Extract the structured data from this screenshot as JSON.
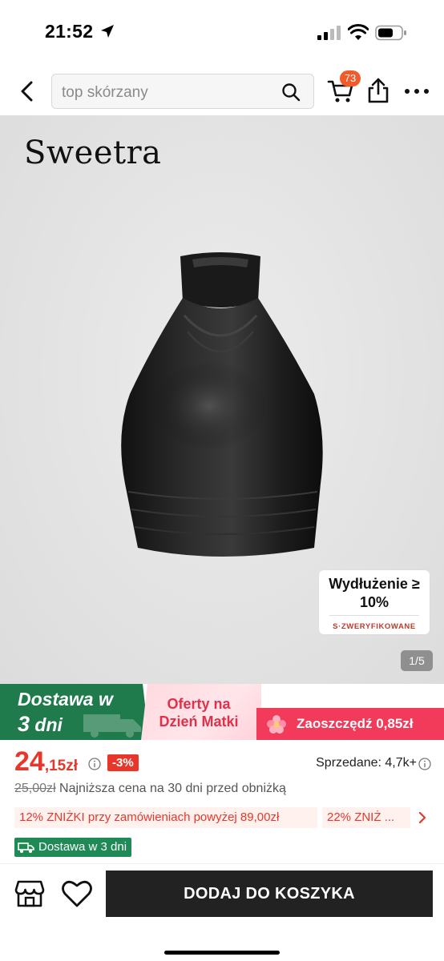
{
  "status_bar": {
    "time": "21:52"
  },
  "nav": {
    "search_placeholder": "top skórzany",
    "cart_count": "73"
  },
  "product": {
    "brand": "Sweetra",
    "verified_badge": {
      "title": "Wydłużenie ≥ 10%",
      "subtitle": "S·ZWERYFIKOWANE"
    },
    "image_pager": "1/5"
  },
  "promo": {
    "delivery_line1": "Dostawa w",
    "delivery_line2_num": "3",
    "delivery_line2_unit": "dni",
    "mothers_day": "Oferty na Dzień Matki",
    "savings": "Zaoszczędź 0,85zł"
  },
  "price": {
    "integer": "24",
    "rest": ",15zł",
    "discount": "-3%",
    "sold": "Sprzedane: 4,7k+",
    "old_price": "25,00zł",
    "lowest_note": "Najniższa cena na 30 dni przed obniżką"
  },
  "coupons": [
    "12% ZNIŻKI przy zamówieniach powyżej 89,00zł",
    "22% ZNIŻ ..."
  ],
  "delivery_tag": "Dostawa w 3 dni",
  "bottom_bar": {
    "add_to_cart": "DODAJ DO KOSZYKA"
  },
  "colors": {
    "price_red": "#e8372a",
    "delivery_green": "#1f7a4c",
    "cart_badge": "#f25a2a",
    "button_dark": "#222222"
  },
  "icons": [
    "location-arrow-icon",
    "signal-icon",
    "wifi-icon",
    "battery-icon",
    "back-chevron-icon",
    "search-icon",
    "cart-icon",
    "share-icon",
    "more-dots-icon",
    "info-icon",
    "chevron-right-icon",
    "truck-icon",
    "store-icon",
    "heart-icon"
  ]
}
